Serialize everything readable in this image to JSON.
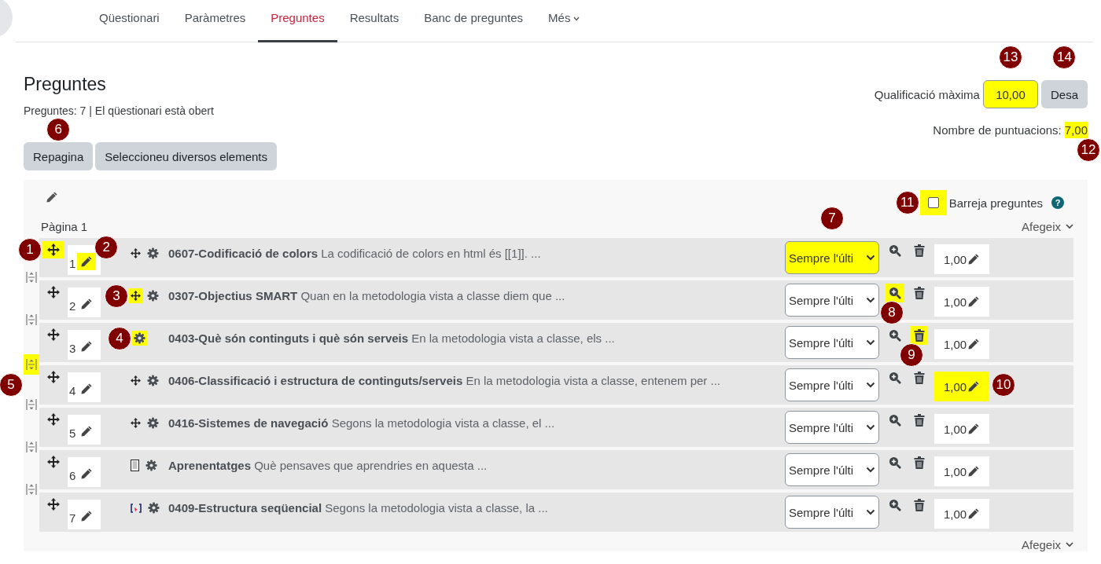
{
  "nav": {
    "tabs": [
      {
        "label": "Qüestionari",
        "selected": false,
        "menu": false
      },
      {
        "label": "Paràmetres",
        "selected": false,
        "menu": false
      },
      {
        "label": "Preguntes",
        "selected": true,
        "menu": false
      },
      {
        "label": "Resultats",
        "selected": false,
        "menu": false
      },
      {
        "label": "Banc de preguntes",
        "selected": false,
        "menu": false
      },
      {
        "label": "Més",
        "selected": false,
        "menu": true
      }
    ]
  },
  "heading": "Preguntes",
  "summary": "Preguntes: 7 | El qüestionari està obert",
  "actions": [
    {
      "label": "Repagina",
      "marker": "6"
    },
    {
      "label": "Seleccioneu diversos elements"
    }
  ],
  "max_grade": {
    "label": "Qualificació màxima",
    "value": "10,00",
    "highlighted": true,
    "marker": "13"
  },
  "save_button": {
    "label": "Desa",
    "marker": "14"
  },
  "total_marks": {
    "label": "Nombre de puntuacions:",
    "value": "7,00",
    "highlighted": true,
    "marker": "12"
  },
  "shuffle": {
    "label": "Barreja preguntes",
    "checked": false,
    "highlighted": true,
    "marker": "11",
    "help": "?"
  },
  "page": {
    "label": "Pàgina 1",
    "add_menu": "Afegeix"
  },
  "questions": [
    {
      "number": "1",
      "kind": "drag",
      "name": "0607-Codificació de colors",
      "text": "La codificació de colors en html és [[1]]. ...",
      "behaviour": "Sempre l'últi",
      "mark": "1,00",
      "callouts": {
        "handle": "1",
        "edit": "2",
        "behaviour": "7"
      }
    },
    {
      "number": "2",
      "kind": "drag",
      "name": "0307-Objectius SMART",
      "text": "Quan en la metodologia vista a classe diem que ...",
      "behaviour": "Sempre l'últi",
      "mark": "1,00",
      "callouts": {
        "type": "3",
        "preview": "8"
      }
    },
    {
      "number": "3",
      "name": "0403-Què són continguts i què són serveis",
      "text": "En la metodologia vista a classe, els ...",
      "behaviour": "Sempre l'últi",
      "mark": "1,00",
      "callouts": {
        "gear": "4",
        "delete": "9"
      }
    },
    {
      "number": "4",
      "kind": "drag",
      "name": "0406-Classificació i estructura de continguts/serveis",
      "text": "En la metodologia vista a classe, entenem per ...",
      "behaviour": "Sempre l'últi",
      "mark": "1,00",
      "callouts": {
        "split": "5",
        "mark": "10"
      }
    },
    {
      "number": "5",
      "kind": "drag",
      "name": "0416-Sistemes de navegació",
      "text": "Segons la metodologia vista a classe, el ...",
      "behaviour": "Sempre l'últi",
      "mark": "1,00"
    },
    {
      "number": "6",
      "kind": "essay",
      "name": "Aprenentatges",
      "text": "Què pensaves que aprendries en aquesta ...",
      "behaviour": "Sempre l'últi",
      "mark": "1,00"
    },
    {
      "number": "7",
      "kind": "cloze",
      "name": "0409-Estructura seqüencial",
      "text": "Segons la metodologia vista a classe, la ...",
      "behaviour": "Sempre l'últi",
      "mark": "1,00"
    }
  ],
  "footer_add_menu": "Afegeix"
}
